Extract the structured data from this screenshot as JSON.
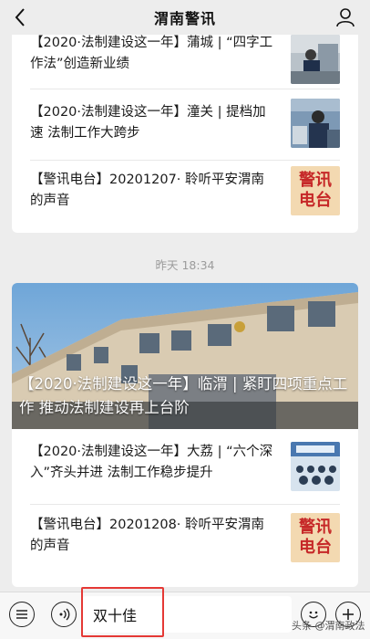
{
  "header": {
    "title": "渭南警讯",
    "back_icon": "chevron-left-icon",
    "profile_icon": "person-icon"
  },
  "message1": {
    "items": [
      {
        "text": "【2020·法制建设这一年】蒲城 | “四字工作法”创造新业绩"
      },
      {
        "text": "【2020·法制建设这一年】潼关 | 提档加速 法制工作大跨步"
      },
      {
        "text": "【警讯电台】20201207· 聆听平安渭南的声音"
      }
    ],
    "radio_badge": {
      "line1": "警讯",
      "line2": "电台"
    }
  },
  "timestamp": "昨天 18:34",
  "message2": {
    "hero_caption": "【2020·法制建设这一年】临渭 | 紧盯四项重点工作 推动法制建设再上台阶",
    "items": [
      {
        "text": "【2020·法制建设这一年】大荔 | “六个深入”齐头并进 法制工作稳步提升"
      },
      {
        "text": "【警讯电台】20201208· 聆听平安渭南的声音"
      }
    ],
    "radio_badge": {
      "line1": "警讯",
      "line2": "电台"
    }
  },
  "bottom": {
    "menu_icon": "menu-list-icon",
    "voice_icon": "voice-icon",
    "input_value": "双十佳",
    "emoji_icon": "emoji-icon",
    "plus_icon": "plus-icon"
  },
  "watermark": "头条 @渭南政法",
  "colors": {
    "highlight": "#e53935",
    "badge_red": "#c62828",
    "badge_bg": "#f3d9b1"
  }
}
